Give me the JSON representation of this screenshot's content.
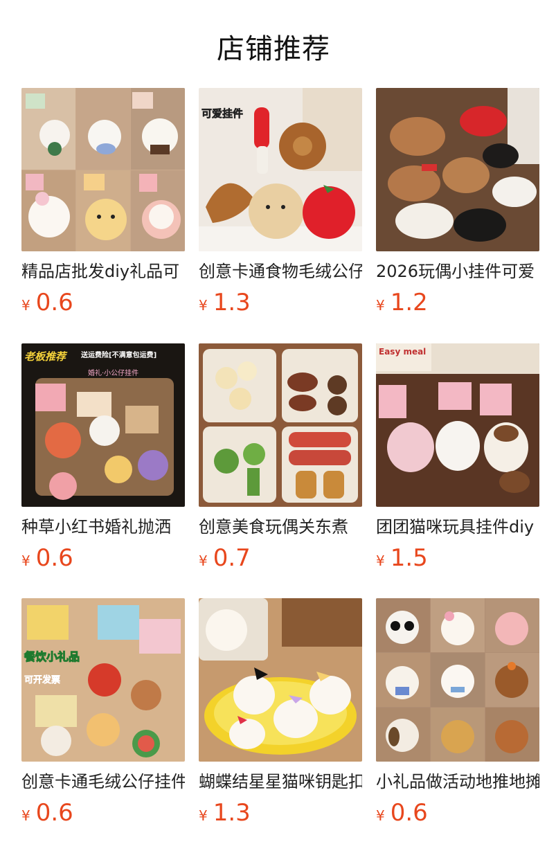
{
  "page": {
    "title": "店铺推荐"
  },
  "products": [
    {
      "name": "精品店批发diy礼品可",
      "currency": "¥",
      "price": "0.6",
      "image": "plush-animal-keychains-grid"
    },
    {
      "name": "创意卡通食物毛绒公仔",
      "currency": "¥",
      "price": "1.3",
      "image": "food-plush-keychains",
      "image_text": "可爱挂件"
    },
    {
      "name": "2026玩偶小挂件可爱",
      "currency": "¥",
      "price": "1.2",
      "image": "plush-horse-keychains"
    },
    {
      "name": "种草小红书婚礼抛洒",
      "currency": "¥",
      "price": "0.6",
      "image": "wedding-gift-plush-bags",
      "image_text": "老板推荐",
      "image_text_2": "送运费险[不满意包运费]",
      "image_text_3": "婚礼·小公仔挂件"
    },
    {
      "name": "创意美食玩偶关东煮",
      "currency": "¥",
      "price": "0.7",
      "image": "food-plush-bento-box"
    },
    {
      "name": "团团猫咪玩具挂件diy",
      "currency": "¥",
      "price": "1.5",
      "image": "cat-plush-keychains",
      "image_text": "Easy meal"
    },
    {
      "name": "创意卡通毛绒公仔挂件",
      "currency": "¥",
      "price": "0.6",
      "image": "cartoon-plush-gift-bags",
      "image_text": "餐饮小礼品",
      "image_text_2": "可开发票"
    },
    {
      "name": "蝴蝶结星星猫咪钥匙扣",
      "currency": "¥",
      "price": "1.3",
      "image": "bow-star-cat-plush-basket"
    },
    {
      "name": "小礼品做活动地推地摊",
      "currency": "¥",
      "price": "0.6",
      "image": "assorted-animal-plush-grid"
    }
  ],
  "colors": {
    "price": "#e8471d",
    "text": "#222222",
    "background": "#ffffff"
  }
}
